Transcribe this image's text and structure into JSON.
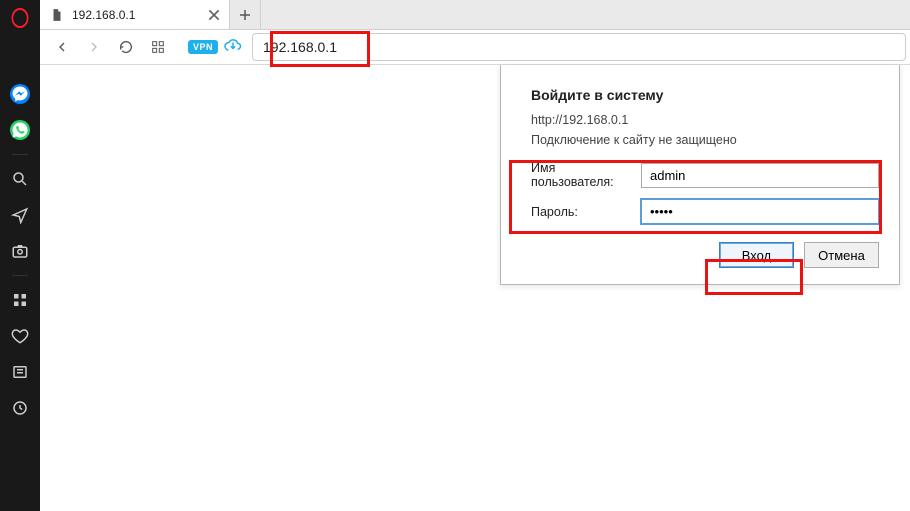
{
  "tab": {
    "title": "192.168.0.1"
  },
  "address": {
    "value": "192.168.0.1"
  },
  "vpn": {
    "label": "VPN"
  },
  "auth": {
    "title": "Войдите в систему",
    "url": "http://192.168.0.1",
    "warning": "Подключение к сайту не защищено",
    "username_label": "Имя пользователя:",
    "username_value": "admin",
    "password_label": "Пароль:",
    "password_value": "•••••",
    "login_label": "Вход",
    "cancel_label": "Отмена"
  }
}
